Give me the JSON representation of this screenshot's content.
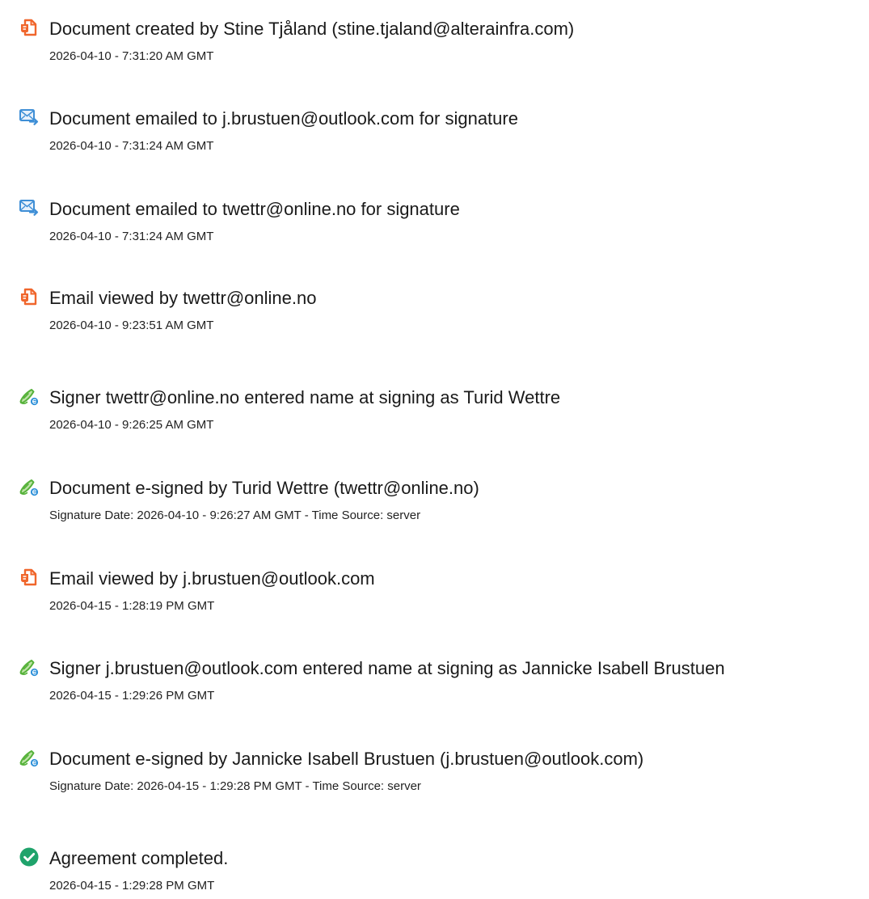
{
  "events": [
    {
      "icon": "document-orange-icon",
      "title": "Document created by Stine Tjåland (stine.tjaland@alterainfra.com)",
      "detail": "2026-04-10 - 7:31:20 AM GMT"
    },
    {
      "icon": "email-send-icon",
      "title": "Document emailed to j.brustuen@outlook.com for signature",
      "detail": "2026-04-10 - 7:31:24 AM GMT"
    },
    {
      "icon": "email-send-icon",
      "title": "Document emailed to twettr@online.no for signature",
      "detail": "2026-04-10 - 7:31:24 AM GMT"
    },
    {
      "icon": "document-orange-icon",
      "title": "Email viewed by twettr@online.no",
      "detail": "2026-04-10 - 9:23:51 AM GMT"
    },
    {
      "icon": "esign-pen-icon",
      "title": "Signer twettr@online.no entered name at signing as Turid Wettre",
      "detail": "2026-04-10 - 9:26:25 AM GMT"
    },
    {
      "icon": "esign-pen-icon",
      "title": "Document e-signed by Turid Wettre (twettr@online.no)",
      "detail": "Signature Date: 2026-04-10 - 9:26:27 AM GMT - Time Source: server"
    },
    {
      "icon": "document-orange-icon",
      "title": "Email viewed by j.brustuen@outlook.com",
      "detail": "2026-04-15 - 1:28:19 PM GMT"
    },
    {
      "icon": "esign-pen-icon",
      "title": "Signer j.brustuen@outlook.com entered name at signing as Jannicke Isabell Brustuen",
      "detail": "2026-04-15 - 1:29:26 PM GMT"
    },
    {
      "icon": "esign-pen-icon",
      "title": "Document e-signed by Jannicke Isabell Brustuen (j.brustuen@outlook.com)",
      "detail": "Signature Date: 2026-04-15 - 1:29:28 PM GMT - Time Source: server"
    },
    {
      "icon": "check-circle-icon",
      "title": "Agreement completed.",
      "detail": "2026-04-15 - 1:29:28 PM GMT"
    }
  ],
  "colors": {
    "document_icon": "#f0662c",
    "email_icon": "#3f8fd6",
    "pen_icon": "#56b23a",
    "badge": "#2b8fd8",
    "check_icon": "#1fa36b"
  }
}
